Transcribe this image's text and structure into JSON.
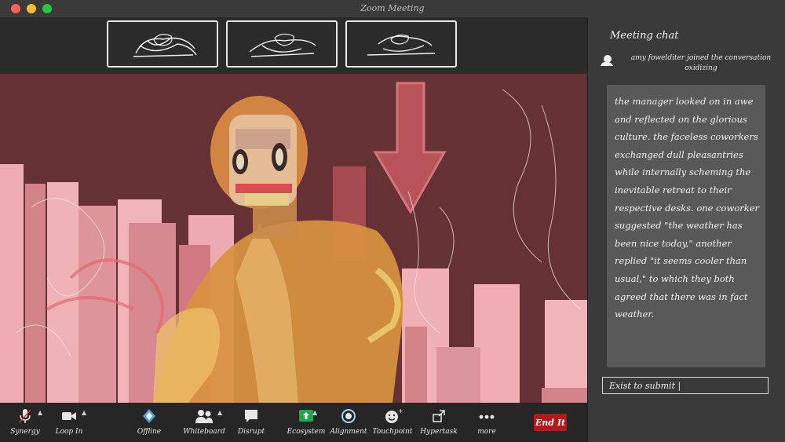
{
  "window": {
    "title": "Zoom Meeting"
  },
  "chat": {
    "title": "Meeting chat",
    "join_user": "amy fowelditer",
    "join_action": "joined the conversation",
    "join_status": "oxidizing",
    "message": "the manager looked on in awe and reflected on the glorious culture. the faceless coworkers exchanged dull pleasantries while internally scheming the inevitable retreat to their respective desks. one coworker suggested \"the weather has been nice today,\" another replied \"it seems cooler than usual,\" to which they both agreed that there was in fact weather.",
    "input_placeholder": "Exist to submit |"
  },
  "toolbar": {
    "items": [
      {
        "label": "Synergy",
        "icon": "microphone-icon"
      },
      {
        "label": "Loop In",
        "icon": "video-camera-icon"
      },
      {
        "label": "Offline",
        "icon": "shield-icon"
      },
      {
        "label": "Whiteboard",
        "icon": "participants-icon"
      },
      {
        "label": "Disrupt",
        "icon": "chat-bubble-icon"
      },
      {
        "label": "Ecosystem",
        "icon": "share-screen-icon"
      },
      {
        "label": "Alignment",
        "icon": "record-icon"
      },
      {
        "label": "Touchpoint",
        "icon": "reactions-icon"
      },
      {
        "label": "Hypertask",
        "icon": "apps-icon"
      },
      {
        "label": "more",
        "icon": "more-dots-icon"
      }
    ],
    "end_label": "End It"
  },
  "colors": {
    "accent_green": "#1fa84a",
    "end_red": "#b3191b",
    "scene_bg": "#6e3539",
    "bar_pink": "#f7b6bd"
  }
}
